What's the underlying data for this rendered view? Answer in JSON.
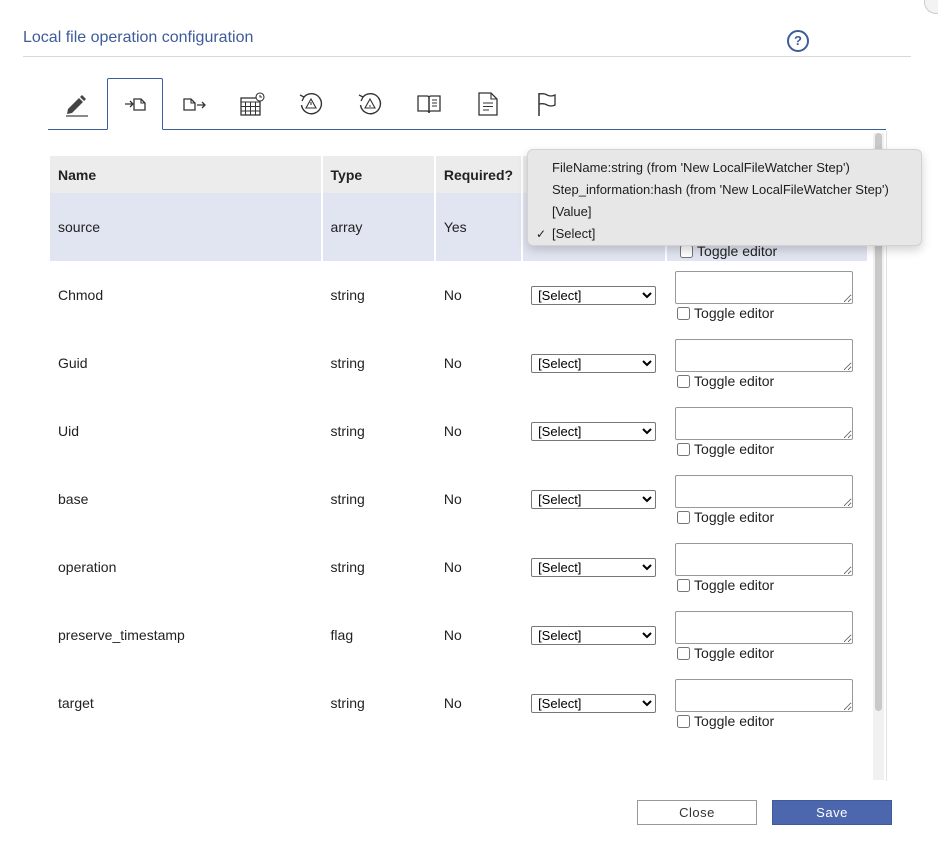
{
  "dialog": {
    "title": "Local file operation configuration",
    "help_label": "?"
  },
  "tabs": [
    {
      "icon": "pencil-icon"
    },
    {
      "icon": "input-file-icon",
      "active": true
    },
    {
      "icon": "output-file-icon"
    },
    {
      "icon": "calendar-schedule-icon"
    },
    {
      "icon": "history-warning-icon"
    },
    {
      "icon": "history-alert-icon"
    },
    {
      "icon": "book-icon"
    },
    {
      "icon": "document-icon"
    },
    {
      "icon": "flag-icon"
    }
  ],
  "table": {
    "headers": {
      "name": "Name",
      "type": "Type",
      "required": "Required?"
    },
    "rows": [
      {
        "name": "source",
        "type": "array",
        "required": "Yes",
        "source": "[Select]",
        "toggle": "Toggle editor"
      },
      {
        "name": "Chmod",
        "type": "string",
        "required": "No",
        "source": "[Select]",
        "toggle": "Toggle editor"
      },
      {
        "name": "Guid",
        "type": "string",
        "required": "No",
        "source": "[Select]",
        "toggle": "Toggle editor"
      },
      {
        "name": "Uid",
        "type": "string",
        "required": "No",
        "source": "[Select]",
        "toggle": "Toggle editor"
      },
      {
        "name": "base",
        "type": "string",
        "required": "No",
        "source": "[Select]",
        "toggle": "Toggle editor"
      },
      {
        "name": "operation",
        "type": "string",
        "required": "No",
        "source": "[Select]",
        "toggle": "Toggle editor"
      },
      {
        "name": "preserve_timestamp",
        "type": "flag",
        "required": "No",
        "source": "[Select]",
        "toggle": "Toggle editor"
      },
      {
        "name": "target",
        "type": "string",
        "required": "No",
        "source": "[Select]",
        "toggle": "Toggle editor"
      }
    ]
  },
  "dropdown": {
    "options": [
      "FileName:string (from 'New LocalFileWatcher Step')",
      "Step_information:hash (from 'New LocalFileWatcher Step')",
      "[Value]",
      "[Select]"
    ],
    "selected_index": 3,
    "check_mark": "✓"
  },
  "footer": {
    "close_label": "Close",
    "save_label": "Save"
  },
  "colors": {
    "accent": "#3d5c9a",
    "save_button": "#4c67ad",
    "highlight_row": "#e1e5f1"
  }
}
